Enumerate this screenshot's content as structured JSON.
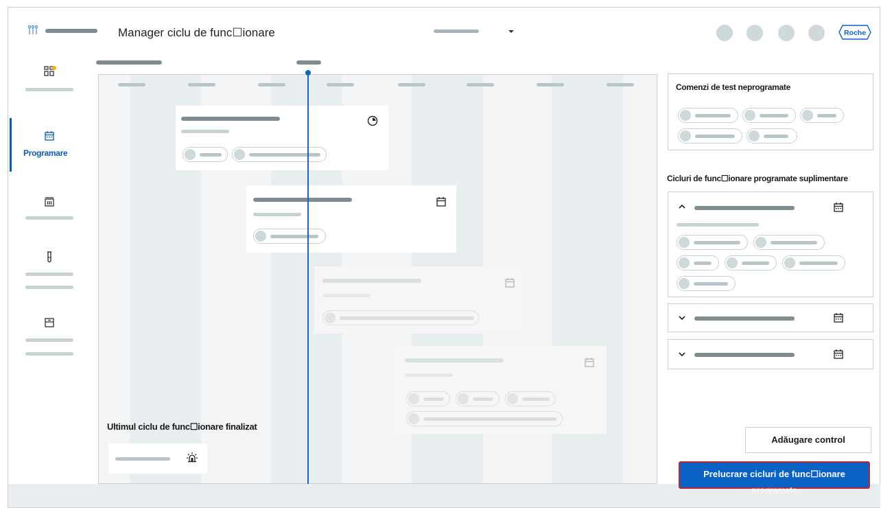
{
  "header": {
    "app_title": "Manager ciclu de func☐ionare",
    "brand": "Roche",
    "icons": [
      "grid-menu-icon",
      "chevron-down-icon",
      "user-avatar-icon"
    ]
  },
  "sidebar": {
    "items": [
      {
        "name": "dashboard",
        "icon": "dashboard-icon",
        "label": ""
      },
      {
        "name": "programare",
        "icon": "calendar-icon",
        "label": "Programare",
        "active": true
      },
      {
        "name": "instrument",
        "icon": "analyzer-icon",
        "label": ""
      },
      {
        "name": "reagents",
        "icon": "test-tube-icon",
        "label": ""
      },
      {
        "name": "storage",
        "icon": "drawer-icon",
        "label": ""
      }
    ],
    "accent_color": "#0b5cab",
    "notification_color": "#f5b400"
  },
  "timeline": {
    "now_color": "#1565c0",
    "cards": [
      {
        "name": "run-card-1",
        "status_icon": "clock-icon",
        "faded": false
      },
      {
        "name": "run-card-2",
        "status_icon": "calendar-icon",
        "faded": false
      },
      {
        "name": "run-card-3",
        "status_icon": "calendar-icon",
        "faded": true
      },
      {
        "name": "run-card-4",
        "status_icon": "calendar-icon",
        "faded": true
      }
    ],
    "last_run": {
      "title": "Ultimul ciclu de func☐ionare finalizat",
      "icon": "alarm-icon"
    }
  },
  "right_panel": {
    "unscheduled_title": "Comenzi de test neprogramate",
    "additional_title": "Cicluri de func☐ionare programate suplimentare",
    "groups": [
      {
        "name": "group-1",
        "expanded": true
      },
      {
        "name": "group-2",
        "expanded": false
      },
      {
        "name": "group-3",
        "expanded": false
      }
    ]
  },
  "actions": {
    "add_control": "Adăugare control",
    "process_line1": "Prelucrare cicluri de func☐ionare",
    "process_line2": "programate",
    "primary_color": "#0b62c5",
    "focus_color": "#c0262d"
  }
}
